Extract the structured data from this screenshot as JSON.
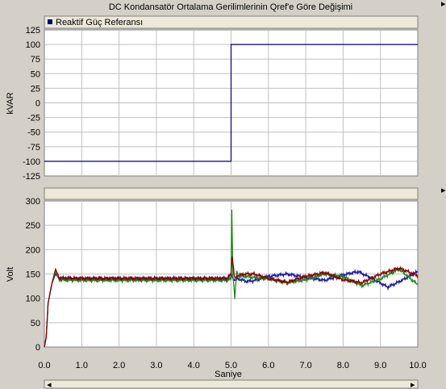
{
  "title": "DC Kondansatör Ortalama Gerilimlerinin Qref'e Göre Değişimi",
  "colors": {
    "background": "#d4d0c8",
    "plot_bg": "#ffffff",
    "grid": "#c0c0c0",
    "ref_line": "#000080",
    "blue": "#1a1aa6",
    "green": "#1f8a1f",
    "red": "#8b0000"
  },
  "chart_data": [
    {
      "type": "line",
      "title": "",
      "xlabel": "",
      "ylabel": "kVAR",
      "ylim": [
        -125,
        125
      ],
      "yticks": [
        125,
        100,
        75,
        50,
        25,
        0,
        -25,
        -50,
        -75,
        -100,
        -125
      ],
      "xlim": [
        0,
        10
      ],
      "grid": true,
      "legend": "top-left",
      "series": [
        {
          "name": "Reaktif Güç Referansı",
          "color": "#000080",
          "x": [
            0,
            5,
            5,
            10
          ],
          "y": [
            -100,
            -100,
            100,
            100
          ]
        }
      ]
    },
    {
      "type": "line",
      "title": "",
      "xlabel": "Saniye",
      "ylabel": "Volt",
      "ylim": [
        0,
        300
      ],
      "yticks": [
        300,
        250,
        200,
        150,
        100,
        50,
        0
      ],
      "xlim": [
        0,
        10
      ],
      "xticks": [
        "0.0",
        "1.0",
        "2.0",
        "3.0",
        "4.0",
        "5.0",
        "6.0",
        "7.0",
        "8.0",
        "9.0",
        "10.0"
      ],
      "grid": true,
      "series": [
        {
          "color": "#1a1aa6",
          "x": [
            0,
            0.05,
            0.1,
            0.2,
            0.3,
            0.4,
            1,
            2,
            3,
            4,
            4.9,
            5.0,
            5.05,
            5.1,
            5.2,
            5.4,
            5.6,
            6.0,
            6.5,
            7.0,
            7.5,
            8.0,
            8.4,
            8.8,
            9.2,
            9.6,
            10.0
          ],
          "y": [
            0,
            20,
            90,
            130,
            150,
            140,
            140,
            140,
            140,
            140,
            140,
            150,
            140,
            138,
            140,
            135,
            136,
            145,
            150,
            143,
            137,
            148,
            155,
            140,
            123,
            138,
            155
          ]
        },
        {
          "color": "#1f8a1f",
          "x": [
            0,
            0.05,
            0.1,
            0.2,
            0.3,
            0.4,
            1,
            2,
            3,
            4,
            4.9,
            5.0,
            5.02,
            5.05,
            5.1,
            5.15,
            5.2,
            5.4,
            5.6,
            6.0,
            6.5,
            7.0,
            7.5,
            8.0,
            8.5,
            9.0,
            9.5,
            10.0
          ],
          "y": [
            0,
            20,
            90,
            130,
            155,
            138,
            137,
            137,
            137,
            137,
            137,
            140,
            282,
            150,
            100,
            155,
            145,
            145,
            143,
            140,
            132,
            138,
            150,
            145,
            126,
            140,
            160,
            128
          ]
        },
        {
          "color": "#8b0000",
          "x": [
            0,
            0.05,
            0.1,
            0.2,
            0.3,
            0.4,
            1,
            2,
            3,
            4,
            4.9,
            5.0,
            5.03,
            5.1,
            5.2,
            5.4,
            5.6,
            6.0,
            6.5,
            7.0,
            7.5,
            8.0,
            8.5,
            9.0,
            9.5,
            10.0
          ],
          "y": [
            0,
            20,
            90,
            130,
            160,
            142,
            141,
            141,
            141,
            141,
            141,
            150,
            185,
            140,
            148,
            150,
            150,
            141,
            133,
            145,
            153,
            138,
            132,
            150,
            162,
            147
          ]
        }
      ]
    }
  ]
}
